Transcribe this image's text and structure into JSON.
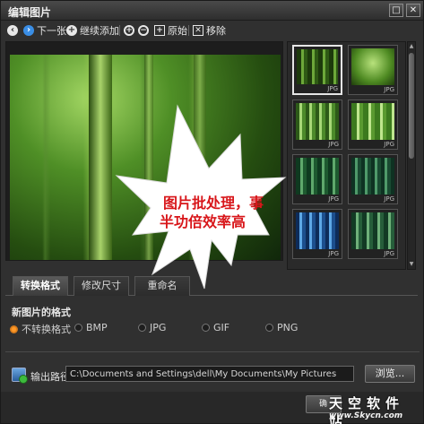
{
  "window": {
    "title": "编辑图片"
  },
  "titlebar_buttons": {
    "restore": "□",
    "close": "✕"
  },
  "toolbar": {
    "prev_icon": "arrow-left-icon",
    "next_label": "下一张",
    "add_label": "继续添加",
    "zoom_in_icon": "zoom-in-icon",
    "zoom_out_icon": "zoom-out-icon",
    "original_label": "原始",
    "remove_label": "移除"
  },
  "thumbnails": [
    {
      "format": "JPG",
      "selected": true
    },
    {
      "format": "JPG",
      "selected": false
    },
    {
      "format": "JPG",
      "selected": false
    },
    {
      "format": "JPG",
      "selected": false
    },
    {
      "format": "JPG",
      "selected": false
    },
    {
      "format": "JPG",
      "selected": false
    },
    {
      "format": "JPG",
      "selected": false
    },
    {
      "format": "JPG",
      "selected": false
    }
  ],
  "tabs": [
    {
      "label": "转换格式",
      "active": true
    },
    {
      "label": "修改尺寸",
      "active": false
    },
    {
      "label": "重命名",
      "active": false
    }
  ],
  "format_section": {
    "title": "新图片的格式",
    "options": [
      {
        "label": "不转换格式",
        "checked": true
      },
      {
        "label": "BMP",
        "checked": false
      },
      {
        "label": "JPG",
        "checked": false
      },
      {
        "label": "GIF",
        "checked": false
      },
      {
        "label": "PNG",
        "checked": false
      }
    ]
  },
  "output": {
    "label": "输出路径",
    "path": "C:\\Documents and Settings\\dell\\My Documents\\My Pictures",
    "browse_label": "浏览..."
  },
  "bottom": {
    "button_partial": "确"
  },
  "callout": {
    "line1": "图片批处理，事",
    "line2": "半功倍效率高"
  },
  "watermark": {
    "top": "天空软件站",
    "url": "www.Skycn.com"
  },
  "colors": {
    "accent_radio": "#ff9a2a",
    "callout_text": "#d8161a"
  }
}
